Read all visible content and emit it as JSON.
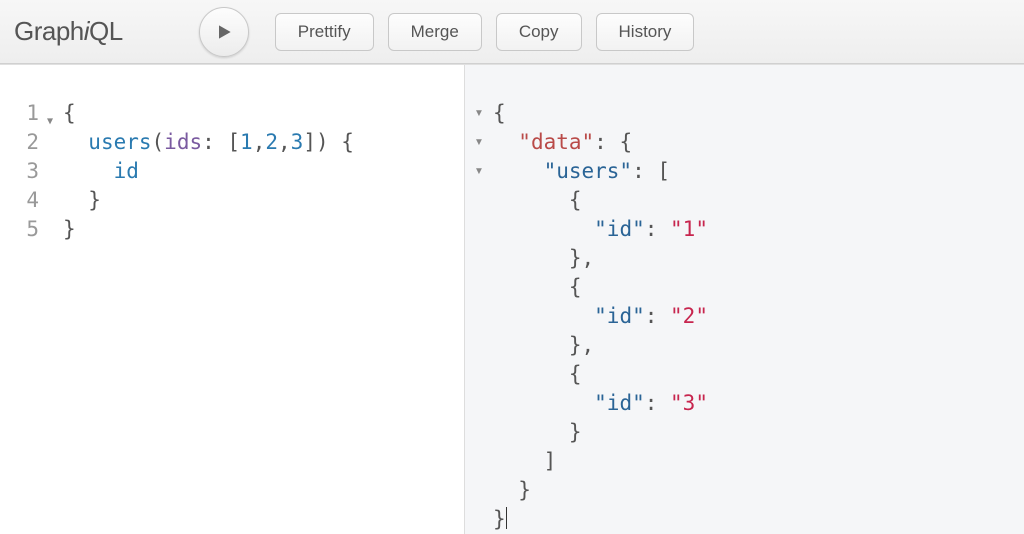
{
  "logo": {
    "pre": "Graph",
    "i": "i",
    "post": "QL"
  },
  "toolbar": {
    "prettify": "Prettify",
    "merge": "Merge",
    "copy": "Copy",
    "history": "History"
  },
  "query": {
    "line_numbers": [
      "1",
      "2",
      "3",
      "4",
      "5"
    ],
    "tokens": [
      [
        {
          "t": "{",
          "c": "tok-punc"
        }
      ],
      [
        {
          "t": "  ",
          "c": ""
        },
        {
          "t": "users",
          "c": "tok-field"
        },
        {
          "t": "(",
          "c": "tok-punc"
        },
        {
          "t": "ids",
          "c": "tok-attr"
        },
        {
          "t": ": [",
          "c": "tok-punc"
        },
        {
          "t": "1",
          "c": "tok-num"
        },
        {
          "t": ",",
          "c": "tok-punc"
        },
        {
          "t": "2",
          "c": "tok-num"
        },
        {
          "t": ",",
          "c": "tok-punc"
        },
        {
          "t": "3",
          "c": "tok-num"
        },
        {
          "t": "]) {",
          "c": "tok-punc"
        }
      ],
      [
        {
          "t": "    ",
          "c": ""
        },
        {
          "t": "id",
          "c": "tok-field"
        }
      ],
      [
        {
          "t": "  }",
          "c": "tok-punc"
        }
      ],
      [
        {
          "t": "}",
          "c": "tok-punc"
        }
      ]
    ]
  },
  "result": {
    "fold_rows": [
      true,
      true,
      true,
      false,
      false,
      false,
      false,
      false,
      false,
      false,
      false,
      false,
      false,
      false
    ],
    "tokens": [
      [
        {
          "t": "{",
          "c": ""
        }
      ],
      [
        {
          "t": "  ",
          "c": ""
        },
        {
          "t": "\"data\"",
          "c": "tok-data"
        },
        {
          "t": ": {",
          "c": ""
        }
      ],
      [
        {
          "t": "    ",
          "c": ""
        },
        {
          "t": "\"users\"",
          "c": "tok-key"
        },
        {
          "t": ": [",
          "c": ""
        }
      ],
      [
        {
          "t": "      {",
          "c": ""
        }
      ],
      [
        {
          "t": "        ",
          "c": ""
        },
        {
          "t": "\"id\"",
          "c": "tok-key"
        },
        {
          "t": ": ",
          "c": ""
        },
        {
          "t": "\"1\"",
          "c": "tok-str"
        }
      ],
      [
        {
          "t": "      },",
          "c": ""
        }
      ],
      [
        {
          "t": "      {",
          "c": ""
        }
      ],
      [
        {
          "t": "        ",
          "c": ""
        },
        {
          "t": "\"id\"",
          "c": "tok-key"
        },
        {
          "t": ": ",
          "c": ""
        },
        {
          "t": "\"2\"",
          "c": "tok-str"
        }
      ],
      [
        {
          "t": "      },",
          "c": ""
        }
      ],
      [
        {
          "t": "      {",
          "c": ""
        }
      ],
      [
        {
          "t": "        ",
          "c": ""
        },
        {
          "t": "\"id\"",
          "c": "tok-key"
        },
        {
          "t": ": ",
          "c": ""
        },
        {
          "t": "\"3\"",
          "c": "tok-str"
        }
      ],
      [
        {
          "t": "      }",
          "c": ""
        }
      ],
      [
        {
          "t": "    ]",
          "c": ""
        }
      ],
      [
        {
          "t": "  }",
          "c": ""
        }
      ],
      [
        {
          "t": "}",
          "c": ""
        }
      ]
    ]
  }
}
